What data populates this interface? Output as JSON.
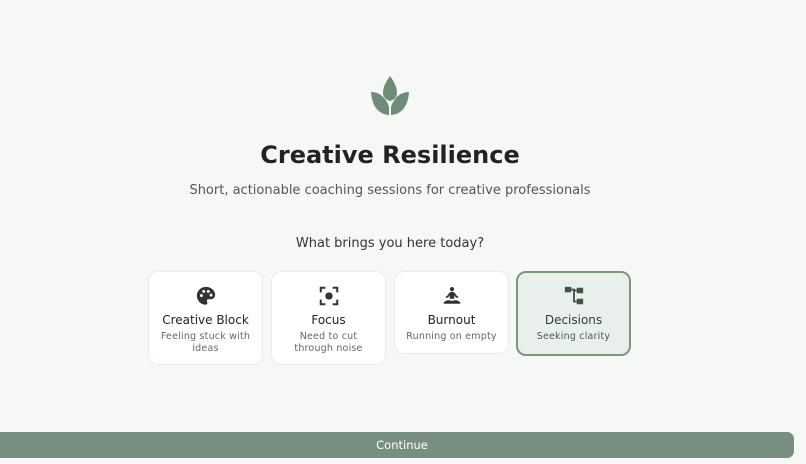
{
  "brand": {
    "title": "Creative Resilience",
    "subtitle": "Short, actionable coaching sessions for creative professionals",
    "logo_icon": "lotus-icon",
    "accent_color": "#6f8c79"
  },
  "onboarding": {
    "question": "What brings you here today?",
    "options": [
      {
        "icon": "palette-icon",
        "label": "Creative Block",
        "description": "Feeling stuck with ideas",
        "selected": false
      },
      {
        "icon": "focus-target-icon",
        "label": "Focus",
        "description": "Need to cut through noise",
        "selected": false
      },
      {
        "icon": "meditation-icon",
        "label": "Burnout",
        "description": "Running on empty",
        "selected": false
      },
      {
        "icon": "decision-tree-icon",
        "label": "Decisions",
        "description": "Seeking clarity",
        "selected": true
      }
    ],
    "continue_label": "Continue"
  }
}
